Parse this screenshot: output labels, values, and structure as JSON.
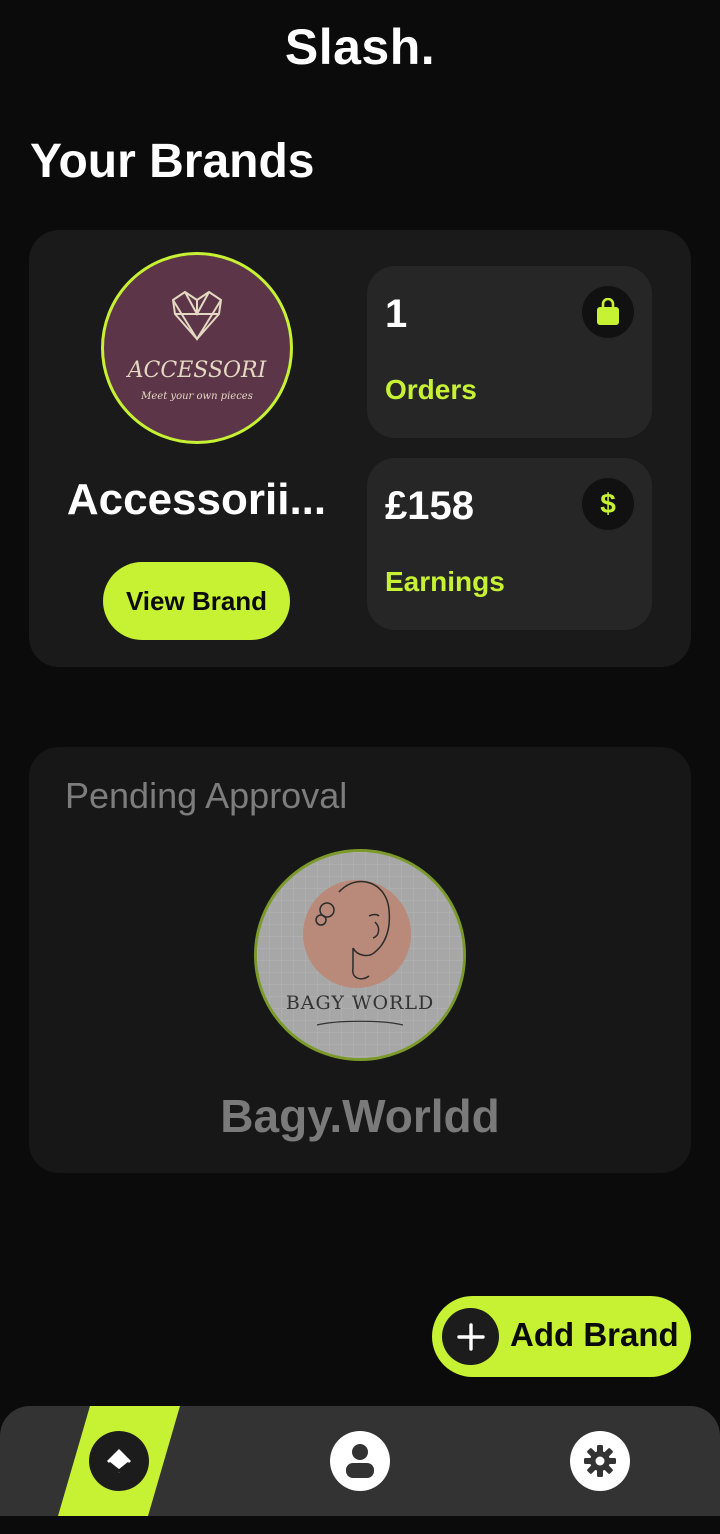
{
  "app": {
    "title": "Slash."
  },
  "page": {
    "section_title": "Your Brands"
  },
  "active_brand": {
    "name": "Accessorii...",
    "logo_text": "ACCESSORI",
    "logo_tagline": "Meet your own pieces",
    "view_button_label": "View Brand",
    "stats": {
      "orders_value": "1",
      "orders_label": "Orders",
      "earnings_value": "£158",
      "earnings_label": "Earnings",
      "earnings_icon": "$"
    }
  },
  "pending_brand": {
    "status_label": "Pending Approval",
    "name": "Bagy.Worldd",
    "logo_text": "BAGY WORLD"
  },
  "actions": {
    "add_brand_label": "Add Brand",
    "add_icon": "+"
  },
  "bottom_nav": {
    "items": [
      {
        "name": "home",
        "icon": "home-diamond-icon",
        "active": true
      },
      {
        "name": "profile",
        "icon": "user-icon",
        "active": false
      },
      {
        "name": "settings",
        "icon": "gear-icon",
        "active": false
      }
    ]
  },
  "colors": {
    "accent": "#c6f233",
    "background": "#0b0b0b",
    "card": "#1a1a1a",
    "tile": "#262626",
    "nav": "#333333",
    "muted_text": "#7d7d7d"
  }
}
